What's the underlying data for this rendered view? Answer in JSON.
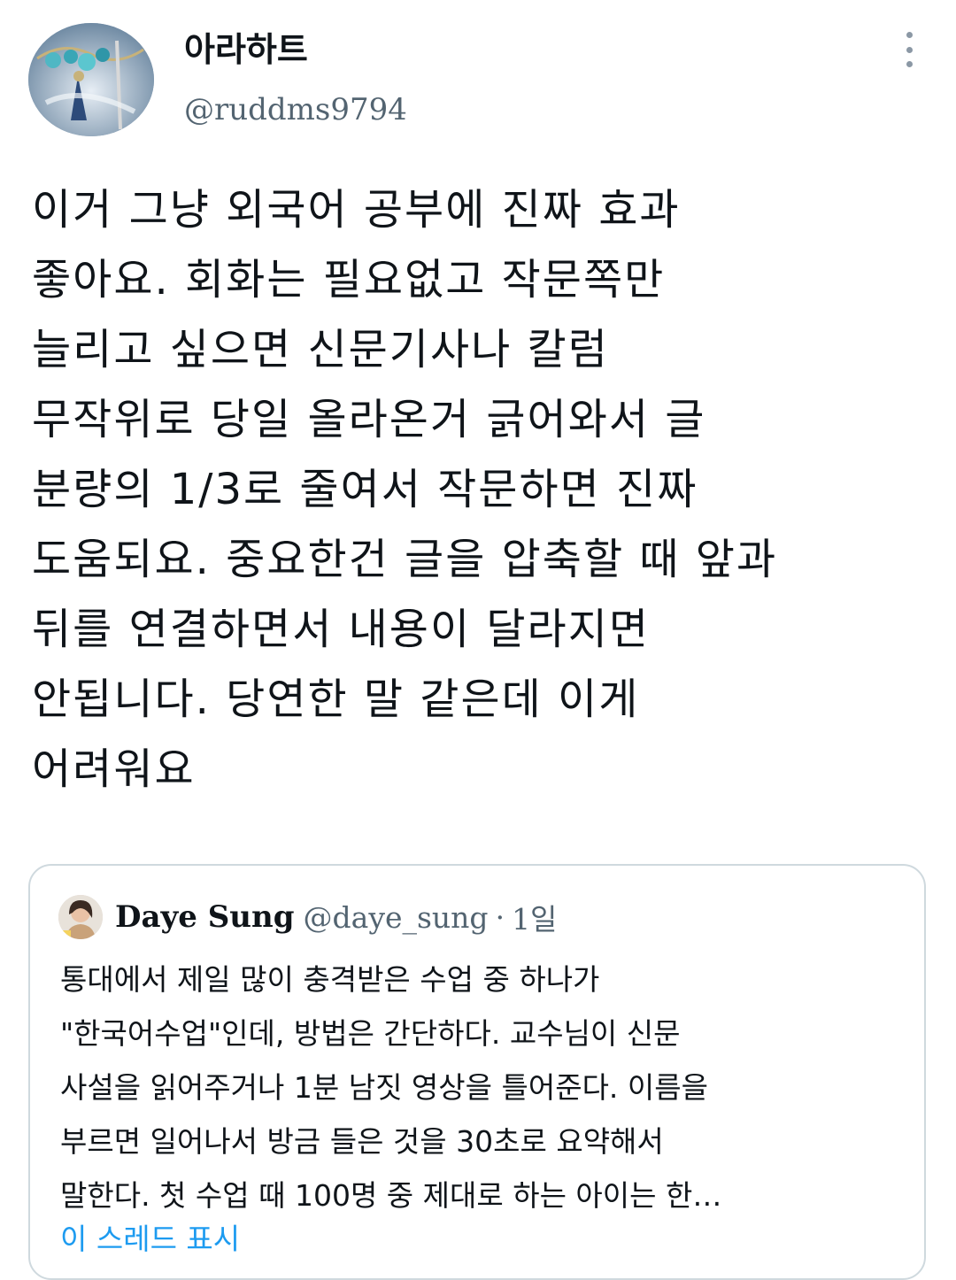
{
  "author": {
    "display_name": "아라하트",
    "handle": "@ruddms9794",
    "avatar_icon": "avatar-image",
    "more_icon": "more-vertical-icon"
  },
  "tweet": {
    "lines": [
      "이거 그냥 외국어 공부에 진짜 효과",
      "좋아요. 회화는 필요없고 작문쪽만",
      "늘리고 싶으면 신문기사나 칼럼",
      "무작위로 당일 올라온거 긁어와서 글",
      "분량의 1/3로 줄여서 작문하면 진짜",
      "도움되요. 중요한건 글을 압축할 때 앞과",
      "뒤를 연결하면서 내용이 달라지면",
      "안됩니다. 당연한 말 같은데 이게",
      "어려워요"
    ]
  },
  "quoted_tweet": {
    "name": "Daye Sung",
    "handle": "@daye_sung",
    "separator": "·",
    "time": "1일",
    "lines": [
      "통대에서 제일 많이 충격받은 수업 중 하나가",
      "\"한국어수업\"인데, 방법은 간단하다. 교수님이 신문",
      "사설을 읽어주거나 1분 남짓 영상을 틀어준다. 이름을",
      "부르면 일어나서 방금 들은 것을 30초로 요약해서",
      "말한다. 첫 수업 때 100명 중 제대로 하는 아이는 한…"
    ],
    "show_thread": "이 스레드 표시"
  },
  "colors": {
    "text_primary": "#0f1419",
    "text_secondary": "#536471",
    "link": "#1d9bf0",
    "border": "#cfd9de"
  }
}
